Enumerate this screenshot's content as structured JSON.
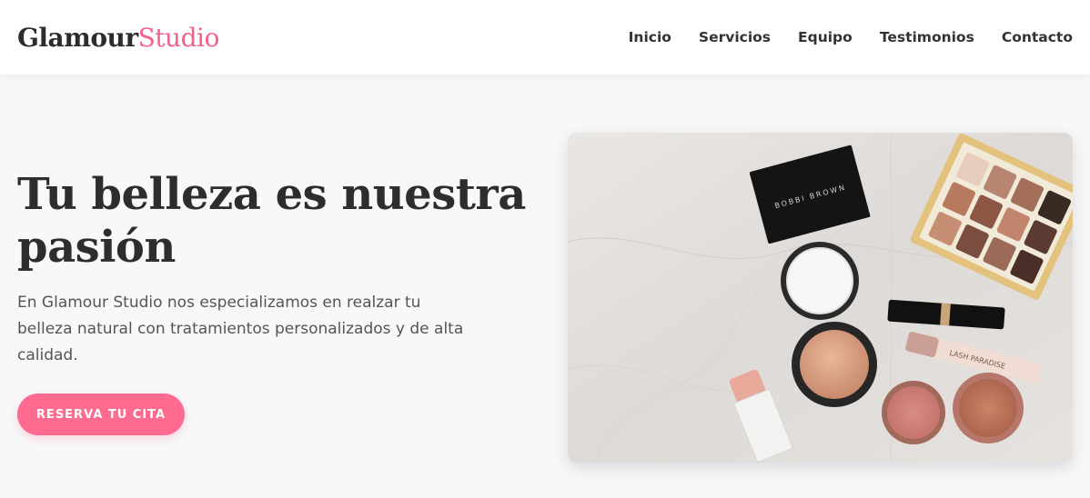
{
  "header": {
    "logo_part1": "Glamour",
    "logo_part2": "Studio",
    "nav": [
      {
        "label": "Inicio"
      },
      {
        "label": "Servicios"
      },
      {
        "label": "Equipo"
      },
      {
        "label": "Testimonios"
      },
      {
        "label": "Contacto"
      }
    ]
  },
  "hero": {
    "title": "Tu belleza es nuestra pasión",
    "description": "En Glamour Studio nos especializamos en realzar tu belleza natural con tratamientos personalizados y de alta calidad.",
    "cta_label": "RESERVA TU CITA",
    "image_brand_text": "BOBBI BROWN",
    "image_mascara_text": "LASH PARADISE"
  },
  "colors": {
    "accent": "#f4628b",
    "button": "#ff6b8e",
    "background": "#f7f8fa",
    "text_dark": "#2d2d2d"
  }
}
